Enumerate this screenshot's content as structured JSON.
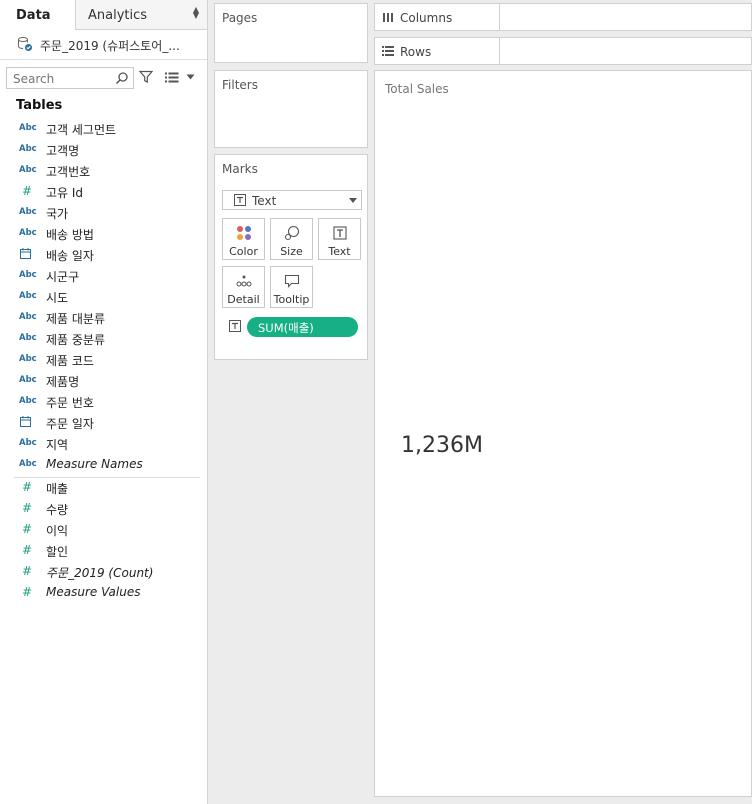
{
  "tabs": {
    "data": "Data",
    "analytics": "Analytics"
  },
  "datasource": {
    "name": "주문_2019 (슈퍼스토어_..."
  },
  "search": {
    "placeholder": "Search"
  },
  "tables_heading": "Tables",
  "fields": [
    {
      "type": "Abc",
      "name": "고객 세그먼트",
      "italic": false
    },
    {
      "type": "Abc",
      "name": "고객명",
      "italic": false
    },
    {
      "type": "Abc",
      "name": "고객번호",
      "italic": false
    },
    {
      "type": "#",
      "name": "고유 Id",
      "italic": false
    },
    {
      "type": "Abc",
      "name": "국가",
      "italic": false
    },
    {
      "type": "Abc",
      "name": "배송 방법",
      "italic": false
    },
    {
      "type": "date",
      "name": "배송 일자",
      "italic": false
    },
    {
      "type": "Abc",
      "name": "시군구",
      "italic": false
    },
    {
      "type": "Abc",
      "name": "시도",
      "italic": false
    },
    {
      "type": "Abc",
      "name": "제품 대분류",
      "italic": false
    },
    {
      "type": "Abc",
      "name": "제품 중분류",
      "italic": false
    },
    {
      "type": "Abc",
      "name": "제품 코드",
      "italic": false
    },
    {
      "type": "Abc",
      "name": "제품명",
      "italic": false
    },
    {
      "type": "Abc",
      "name": "주문 번호",
      "italic": false
    },
    {
      "type": "date",
      "name": "주문 일자",
      "italic": false
    },
    {
      "type": "Abc",
      "name": "지역",
      "italic": false
    },
    {
      "type": "Abc",
      "name": "Measure Names",
      "italic": true
    }
  ],
  "measures": [
    {
      "type": "#",
      "name": "매출",
      "italic": false
    },
    {
      "type": "#",
      "name": "수량",
      "italic": false
    },
    {
      "type": "#",
      "name": "이익",
      "italic": false
    },
    {
      "type": "#",
      "name": "할인",
      "italic": false
    },
    {
      "type": "#",
      "name": "주문_2019 (Count)",
      "italic": true
    },
    {
      "type": "#",
      "name": "Measure Values",
      "italic": true
    }
  ],
  "cards": {
    "pages": "Pages",
    "filters": "Filters",
    "marks": "Marks"
  },
  "marks": {
    "type": "Text",
    "buttons": {
      "color": "Color",
      "size": "Size",
      "text": "Text",
      "detail": "Detail",
      "tooltip": "Tooltip"
    },
    "pill": "SUM(매출)"
  },
  "shelves": {
    "columns": "Columns",
    "rows": "Rows"
  },
  "view": {
    "title": "Total Sales",
    "value": "1,236M"
  },
  "colors": {
    "pill": "#17b085",
    "dimension": "#2a6f9e",
    "measure": "#1f9c82"
  }
}
